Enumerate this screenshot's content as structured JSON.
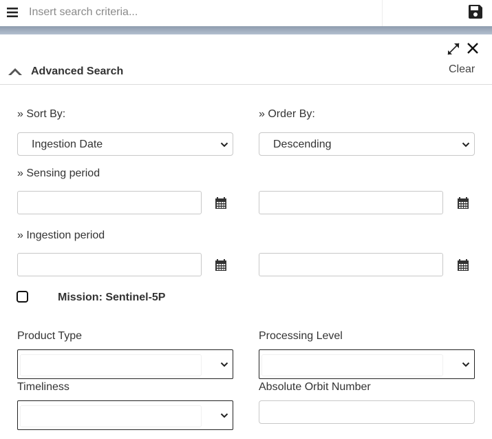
{
  "search": {
    "placeholder": "Insert search criteria..."
  },
  "panel": {
    "title": "Advanced Search",
    "clear_label": "Clear"
  },
  "sort": {
    "label": "» Sort By:",
    "value": "Ingestion Date"
  },
  "order": {
    "label": "» Order By:",
    "value": "Descending"
  },
  "sensing_period": {
    "label": "» Sensing period"
  },
  "ingestion_period": {
    "label": "» Ingestion period"
  },
  "mission": {
    "label": "Mission: Sentinel-5P",
    "checked": false
  },
  "filters": {
    "product_type": {
      "label": "Product Type",
      "value": ""
    },
    "processing_level": {
      "label": "Processing Level",
      "value": ""
    },
    "timeliness": {
      "label": "Timeliness",
      "value": ""
    },
    "absolute_orbit": {
      "label": "Absolute Orbit Number",
      "value": ""
    }
  },
  "icons": [
    "hamburger-menu-icon",
    "save-icon",
    "expand-icon",
    "close-icon",
    "chevron-up-icon",
    "calendar-icon",
    "chevron-down-icon"
  ],
  "colors": {
    "band": "#9aa8b9",
    "text": "#333333",
    "border": "#c8c8c8"
  }
}
